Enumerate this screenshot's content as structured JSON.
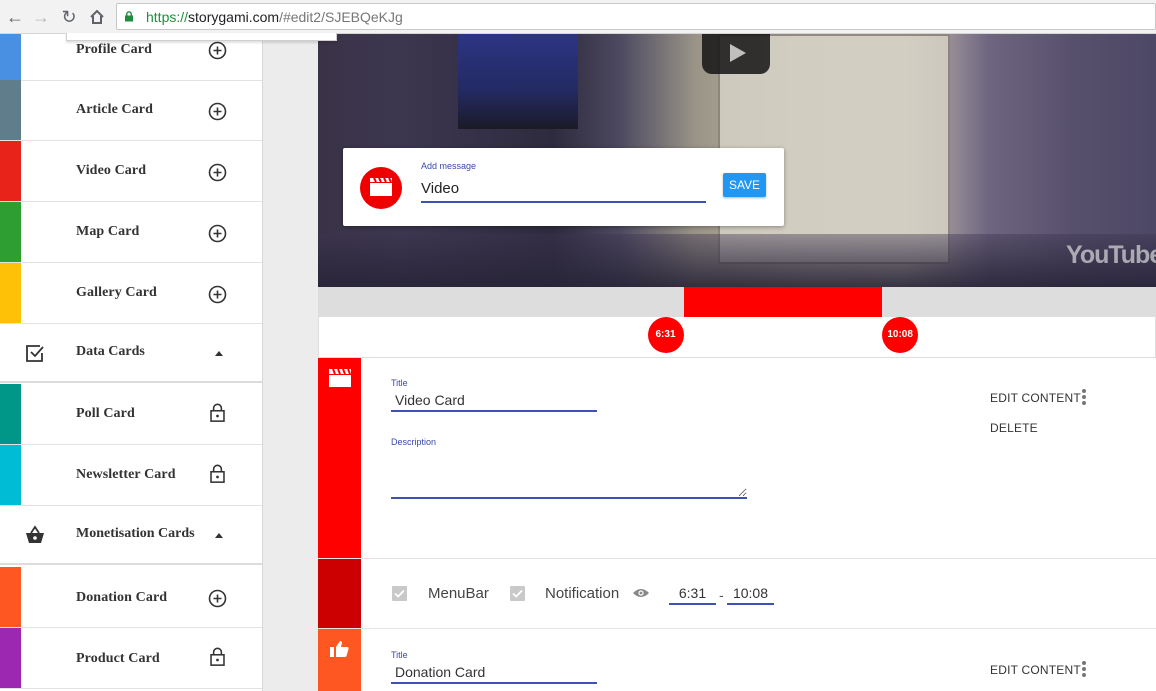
{
  "browser": {
    "url_scheme": "https://",
    "url_host": "storygami.com",
    "url_path": "/#edit2/SJEBQeKJg"
  },
  "sidebar": {
    "items_top": [
      {
        "label": "Profile Card",
        "color": "#4a90e2",
        "action": "add"
      },
      {
        "label": "Article Card",
        "color": "#607d8b",
        "action": "add"
      },
      {
        "label": "Video Card",
        "color": "#e8231a",
        "action": "add"
      },
      {
        "label": "Map Card",
        "color": "#2e9e32",
        "action": "add"
      },
      {
        "label": "Gallery Card",
        "color": "#ffc107",
        "action": "add"
      }
    ],
    "section_data": {
      "label": "Data Cards",
      "icon": "checkbox-icon"
    },
    "items_data": [
      {
        "label": "Poll Card",
        "color": "#009688",
        "action": "locked"
      },
      {
        "label": "Newsletter Card",
        "color": "#00bcd4",
        "action": "locked"
      }
    ],
    "section_money": {
      "label": "Monetisation Cards",
      "icon": "basket-icon"
    },
    "items_money": [
      {
        "label": "Donation Card",
        "color": "#ff5722",
        "action": "add"
      },
      {
        "label": "Product Card",
        "color": "#9c27b0",
        "action": "locked"
      }
    ]
  },
  "video": {
    "watermark": "YouTube"
  },
  "message_card": {
    "label": "Add message",
    "value": "Video",
    "save_label": "SAVE",
    "accent": "#e00000"
  },
  "timeline": {
    "start_label": "6:31",
    "end_label": "10:08",
    "start_fraction": 0.435,
    "end_fraction": 0.672
  },
  "video_card": {
    "title_label": "Title",
    "title_value": "Video Card",
    "description_label": "Description",
    "description_value": "",
    "edit_label": "EDIT CONTENT",
    "delete_label": "DELETE",
    "color": "#ff0000"
  },
  "options": {
    "menubar_label": "MenuBar",
    "notification_label": "Notification",
    "start_time": "6:31",
    "separator": "-",
    "end_time": "10:08"
  },
  "donation_card": {
    "title_label": "Title",
    "title_value": "Donation Card",
    "edit_label": "EDIT CONTENT",
    "color": "#ff5722"
  }
}
